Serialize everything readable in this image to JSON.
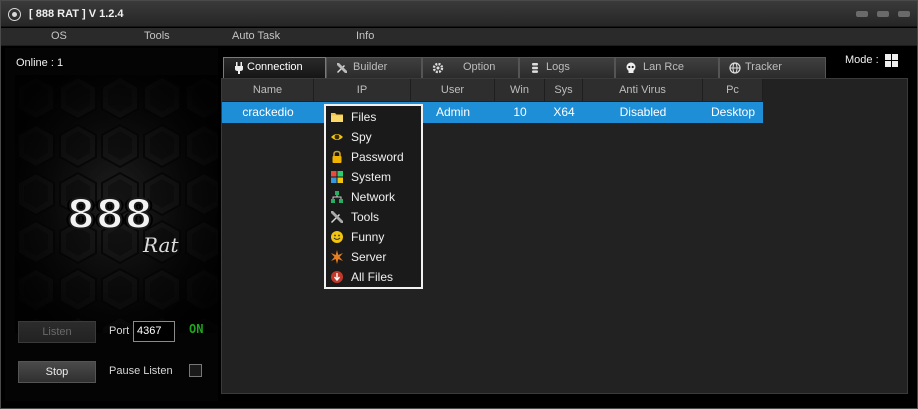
{
  "window": {
    "title": "[ 888 RAT ] V 1.2.4"
  },
  "menu": [
    "OS",
    "Tools",
    "Auto Task",
    "Info"
  ],
  "left_panel": {
    "online_label": "Online : 1",
    "logo_text": "888",
    "logo_sub": "Rat",
    "listen_label": "Listen",
    "port_label": "Port",
    "port_value": "4367",
    "status": "ON",
    "stop_label": "Stop",
    "pause_label": "Pause Listen",
    "pause_checked": false
  },
  "tabs": [
    {
      "label": "Connection",
      "icon": "plug-icon",
      "active": true
    },
    {
      "label": "Builder",
      "icon": "tools-icon",
      "active": false
    },
    {
      "label": "Option",
      "icon": "gear-icon",
      "active": false
    },
    {
      "label": "Logs",
      "icon": "database-icon",
      "active": false
    },
    {
      "label": "Lan Rce",
      "icon": "skull-icon",
      "active": false
    },
    {
      "label": "Tracker",
      "icon": "globe-icon",
      "active": false
    }
  ],
  "mode": {
    "label": "Mode :",
    "icon": "windows-icon"
  },
  "table": {
    "columns": [
      "Name",
      "IP",
      "User",
      "Win",
      "Sys",
      "Anti Virus",
      "Pc"
    ],
    "rows": [
      {
        "Name": "crackedio",
        "IP": "",
        "User": "Admin",
        "Win": "10",
        "Sys": "X64",
        "Anti Virus": "Disabled",
        "Pc": "Desktop",
        "selected": true
      }
    ]
  },
  "context_menu": [
    {
      "label": "Files",
      "icon": "folder-icon"
    },
    {
      "label": "Spy",
      "icon": "eye-icon"
    },
    {
      "label": "Password",
      "icon": "lock-icon"
    },
    {
      "label": "System",
      "icon": "windows-icon"
    },
    {
      "label": "Network",
      "icon": "network-icon"
    },
    {
      "label": "Tools",
      "icon": "tools-icon"
    },
    {
      "label": "Funny",
      "icon": "smiley-icon"
    },
    {
      "label": "Server",
      "icon": "burst-icon"
    },
    {
      "label": "All Files",
      "icon": "download-icon"
    }
  ],
  "colors": {
    "selection": "#1e8ed6",
    "status_on": "#1ea61e",
    "background": "#000000"
  }
}
